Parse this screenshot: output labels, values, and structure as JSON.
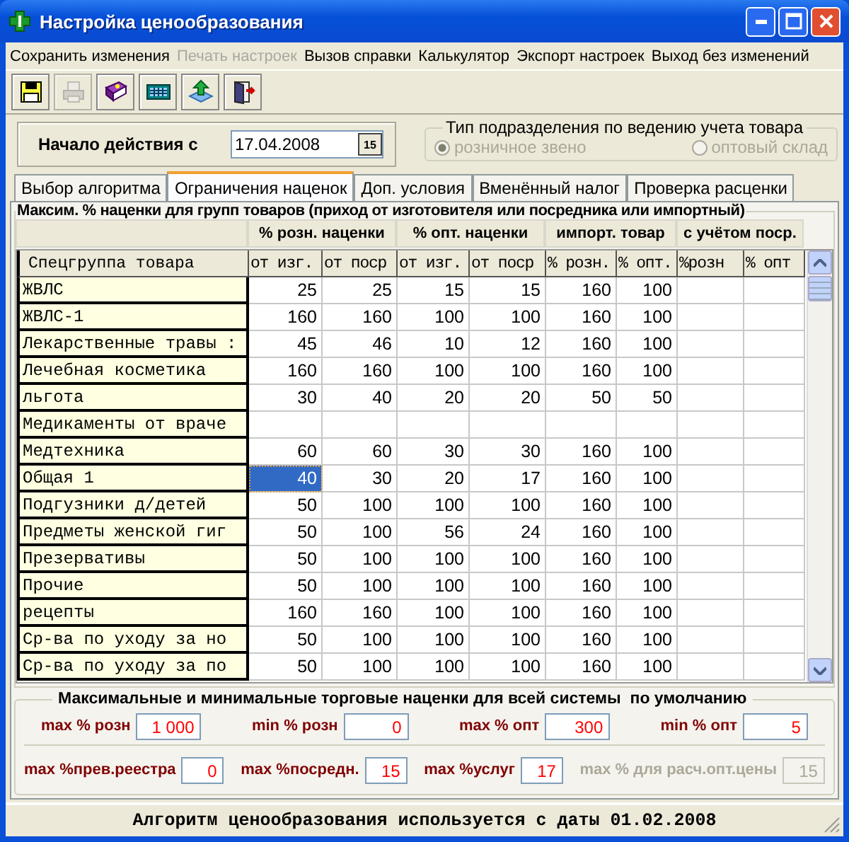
{
  "window": {
    "title": "Настройка ценообразования"
  },
  "menu": [
    {
      "label": "Сохранить изменения",
      "disabled": false
    },
    {
      "label": "Печать настроек",
      "disabled": true
    },
    {
      "label": "Вызов справки",
      "disabled": false
    },
    {
      "label": "Калькулятор",
      "disabled": false
    },
    {
      "label": "Экспорт настроек",
      "disabled": false
    },
    {
      "label": "Выход без изменений",
      "disabled": false
    }
  ],
  "toolbar": [
    {
      "kind": "save",
      "disabled": false
    },
    {
      "kind": "print",
      "disabled": true
    },
    {
      "kind": "help",
      "disabled": false
    },
    {
      "kind": "calculator",
      "disabled": false
    },
    {
      "kind": "export",
      "disabled": false
    },
    {
      "kind": "exit",
      "disabled": false
    }
  ],
  "start_date": {
    "label": "Начало действия с",
    "value": "17.04.2008",
    "button": "15"
  },
  "unit_type": {
    "title": "Тип подразделения по ведению учета товара",
    "disabled": true,
    "options": [
      {
        "label": "розничное звено",
        "selected": true
      },
      {
        "label": "оптовый склад",
        "selected": false
      }
    ]
  },
  "tabs": [
    {
      "label": "Выбор алгоритма",
      "selected": false
    },
    {
      "label": "Ограничения наценок",
      "selected": true
    },
    {
      "label": "Доп. условия",
      "selected": false
    },
    {
      "label": "Вменённый налог",
      "selected": false
    },
    {
      "label": "Проверка расценки",
      "selected": false
    }
  ],
  "group": {
    "title": "Максим. % наценки для групп товаров (приход от изготовителя или посредника или импортный)",
    "column_groups": [
      "% розн. наценки",
      "% опт. наценки",
      "импорт. товар",
      "с учётом поср."
    ],
    "row_header": "Спецгруппа товара",
    "columns": [
      "от изг.",
      "от поср",
      "от изг.",
      "от поср",
      "% розн.",
      "% опт.",
      "%розн",
      "% опт"
    ],
    "rows": [
      {
        "name": "ЖВЛС",
        "cells": [
          {
            "text": "25",
            "selected": false
          },
          {
            "text": "25",
            "selected": false
          },
          {
            "text": "15",
            "selected": false
          },
          {
            "text": "15",
            "selected": false
          },
          {
            "text": "160",
            "selected": false
          },
          {
            "text": "100",
            "selected": false
          }
        ]
      },
      {
        "name": "ЖВЛС-1",
        "cells": [
          {
            "text": "160",
            "selected": false
          },
          {
            "text": "160",
            "selected": false
          },
          {
            "text": "100",
            "selected": false
          },
          {
            "text": "100",
            "selected": false
          },
          {
            "text": "160",
            "selected": false
          },
          {
            "text": "100",
            "selected": false
          }
        ]
      },
      {
        "name": "Лекарственные травы :",
        "cells": [
          {
            "text": "45",
            "selected": false
          },
          {
            "text": "46",
            "selected": false
          },
          {
            "text": "10",
            "selected": false
          },
          {
            "text": "12",
            "selected": false
          },
          {
            "text": "160",
            "selected": false
          },
          {
            "text": "100",
            "selected": false
          }
        ]
      },
      {
        "name": "Лечебная косметика",
        "cells": [
          {
            "text": "160",
            "selected": false
          },
          {
            "text": "160",
            "selected": false
          },
          {
            "text": "100",
            "selected": false
          },
          {
            "text": "100",
            "selected": false
          },
          {
            "text": "160",
            "selected": false
          },
          {
            "text": "100",
            "selected": false
          }
        ]
      },
      {
        "name": "льгота",
        "cells": [
          {
            "text": "30",
            "selected": false
          },
          {
            "text": "40",
            "selected": false
          },
          {
            "text": "20",
            "selected": false
          },
          {
            "text": "20",
            "selected": false
          },
          {
            "text": "50",
            "selected": false
          },
          {
            "text": "50",
            "selected": false
          }
        ]
      },
      {
        "name": "Медикаменты от враче",
        "cells": []
      },
      {
        "name": "Медтехника",
        "cells": [
          {
            "text": "60",
            "selected": false
          },
          {
            "text": "60",
            "selected": false
          },
          {
            "text": "30",
            "selected": false
          },
          {
            "text": "30",
            "selected": false
          },
          {
            "text": "160",
            "selected": false
          },
          {
            "text": "100",
            "selected": false
          }
        ]
      },
      {
        "name": "Общая 1",
        "cells": [
          {
            "text": "40",
            "selected": true
          },
          {
            "text": "30",
            "selected": false
          },
          {
            "text": "20",
            "selected": false
          },
          {
            "text": "17",
            "selected": false
          },
          {
            "text": "160",
            "selected": false
          },
          {
            "text": "100",
            "selected": false
          }
        ]
      },
      {
        "name": "Подгузники д/детей",
        "cells": [
          {
            "text": "50",
            "selected": false
          },
          {
            "text": "100",
            "selected": false
          },
          {
            "text": "100",
            "selected": false
          },
          {
            "text": "100",
            "selected": false
          },
          {
            "text": "160",
            "selected": false
          },
          {
            "text": "100",
            "selected": false
          }
        ]
      },
      {
        "name": "Предметы женской гиг",
        "cells": [
          {
            "text": "50",
            "selected": false
          },
          {
            "text": "100",
            "selected": false
          },
          {
            "text": "56",
            "selected": false
          },
          {
            "text": "24",
            "selected": false
          },
          {
            "text": "160",
            "selected": false
          },
          {
            "text": "100",
            "selected": false
          }
        ]
      },
      {
        "name": "Презервативы",
        "cells": [
          {
            "text": "50",
            "selected": false
          },
          {
            "text": "100",
            "selected": false
          },
          {
            "text": "100",
            "selected": false
          },
          {
            "text": "100",
            "selected": false
          },
          {
            "text": "160",
            "selected": false
          },
          {
            "text": "100",
            "selected": false
          }
        ]
      },
      {
        "name": "Прочие",
        "cells": [
          {
            "text": "50",
            "selected": false
          },
          {
            "text": "100",
            "selected": false
          },
          {
            "text": "100",
            "selected": false
          },
          {
            "text": "100",
            "selected": false
          },
          {
            "text": "160",
            "selected": false
          },
          {
            "text": "100",
            "selected": false
          }
        ]
      },
      {
        "name": "рецепты",
        "cells": [
          {
            "text": "160",
            "selected": false
          },
          {
            "text": "160",
            "selected": false
          },
          {
            "text": "100",
            "selected": false
          },
          {
            "text": "100",
            "selected": false
          },
          {
            "text": "160",
            "selected": false
          },
          {
            "text": "100",
            "selected": false
          }
        ]
      },
      {
        "name": "Ср-ва по уходу за но",
        "cells": [
          {
            "text": "50",
            "selected": false
          },
          {
            "text": "100",
            "selected": false
          },
          {
            "text": "100",
            "selected": false
          },
          {
            "text": "100",
            "selected": false
          },
          {
            "text": "160",
            "selected": false
          },
          {
            "text": "100",
            "selected": false
          }
        ]
      },
      {
        "name": "Ср-ва по уходу за по",
        "cells": [
          {
            "text": "50",
            "selected": false
          },
          {
            "text": "100",
            "selected": false
          },
          {
            "text": "100",
            "selected": false
          },
          {
            "text": "100",
            "selected": false
          },
          {
            "text": "160",
            "selected": false
          },
          {
            "text": "100",
            "selected": false
          }
        ]
      }
    ]
  },
  "defaults": {
    "title": "Максимальные и минимальные торговые наценки для всей системы  по умолчанию",
    "rows": [
      [
        {
          "label": "max % розн",
          "value": "1 000",
          "disabled": false
        },
        {
          "label": "min % розн",
          "value": "0",
          "disabled": false
        },
        {
          "label": "max % опт",
          "value": "300",
          "disabled": false
        },
        {
          "label": "min % опт",
          "value": "5",
          "disabled": false
        }
      ],
      [
        {
          "label": "max %прев.реестра",
          "value": "0",
          "disabled": false
        },
        {
          "label": "max %посредн.",
          "value": "15",
          "disabled": false
        },
        {
          "label": "max %услуг",
          "value": "17",
          "disabled": false
        },
        {
          "label": "max % для расч.опт.цены",
          "value": "15",
          "disabled": true
        }
      ]
    ]
  },
  "status_bar": "Алгоритм ценообразования используется с даты 01.02.2008"
}
